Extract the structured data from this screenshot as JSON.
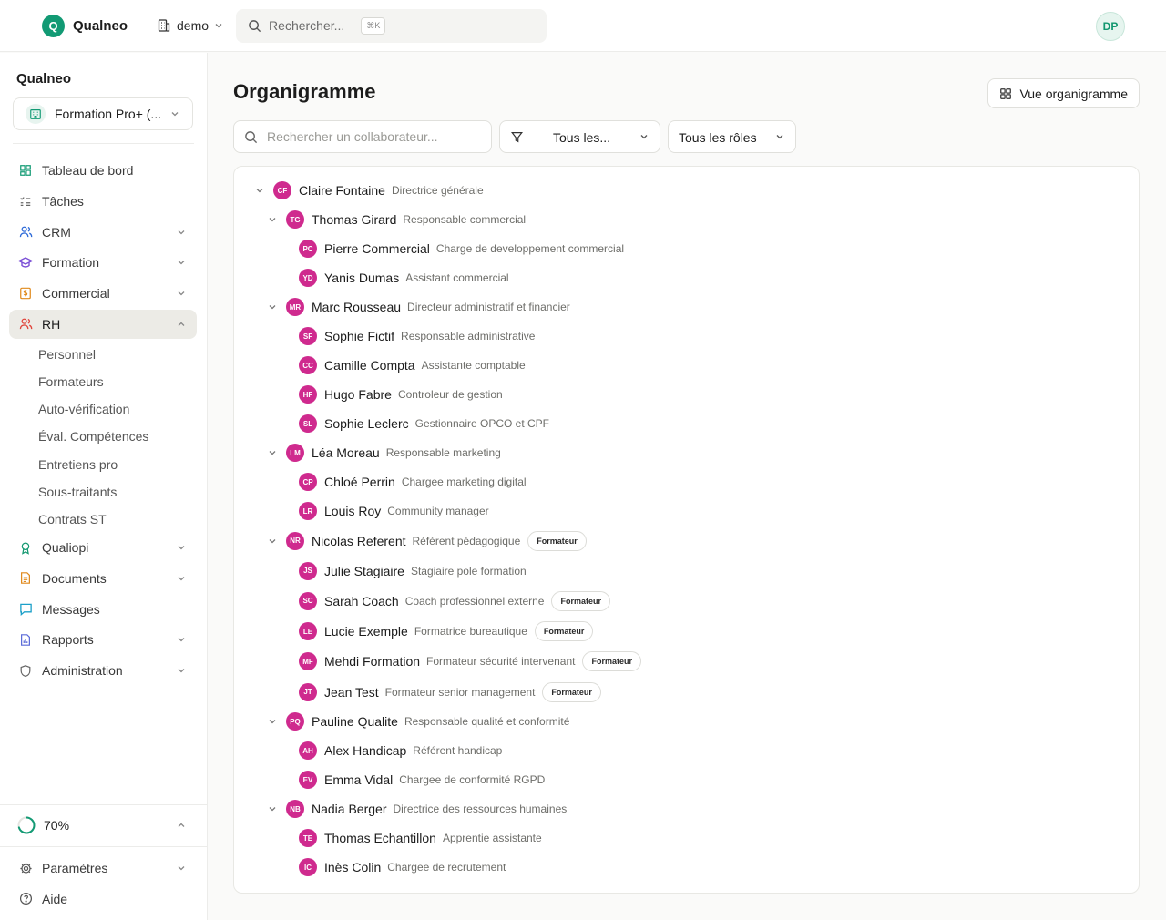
{
  "app": {
    "logo_letter": "Q",
    "brand": "Qualneo",
    "workspace": "demo",
    "search_placeholder": "Rechercher...",
    "search_shortcut": "⌘K",
    "user_initials": "DP"
  },
  "sidebar": {
    "org_title": "Qualneo",
    "org_select": "Formation Pro+ (...",
    "items": [
      {
        "label": "Tableau de bord",
        "icon": "dashboard-icon"
      },
      {
        "label": "Tâches",
        "icon": "tasks-icon"
      },
      {
        "label": "CRM",
        "icon": "users-icon"
      },
      {
        "label": "Formation",
        "icon": "graduation-cap-icon"
      },
      {
        "label": "Commercial",
        "icon": "dollar-file-icon"
      },
      {
        "label": "RH",
        "icon": "people-icon"
      },
      {
        "label": "Qualiopi",
        "icon": "award-icon"
      },
      {
        "label": "Documents",
        "icon": "document-icon"
      },
      {
        "label": "Messages",
        "icon": "message-icon"
      },
      {
        "label": "Rapports",
        "icon": "report-icon"
      },
      {
        "label": "Administration",
        "icon": "shield-icon"
      }
    ],
    "rh_sub": [
      "Personnel",
      "Formateurs",
      "Auto-vérification",
      "Éval. Compétences",
      "Entretiens pro",
      "Sous-traitants",
      "Contrats ST"
    ],
    "progress": {
      "label": "70%",
      "value": 0.7
    },
    "bottom": [
      {
        "label": "Paramètres",
        "icon": "gear-icon"
      },
      {
        "label": "Aide",
        "icon": "help-icon"
      }
    ]
  },
  "main": {
    "title": "Organigramme",
    "view_button": "Vue organigramme",
    "search_placeholder": "Rechercher un collaborateur...",
    "filter_department": "Tous les...",
    "filter_roles": "Tous les rôles"
  },
  "tree": [
    {
      "initials": "CF",
      "name": "Claire Fontaine",
      "role": "Directrice générale",
      "level": 0,
      "expandable": true
    },
    {
      "initials": "TG",
      "name": "Thomas Girard",
      "role": "Responsable commercial",
      "level": 1,
      "expandable": true
    },
    {
      "initials": "PC",
      "name": "Pierre Commercial",
      "role": "Charge de developpement commercial",
      "level": 2
    },
    {
      "initials": "YD",
      "name": "Yanis Dumas",
      "role": "Assistant commercial",
      "level": 2
    },
    {
      "initials": "MR",
      "name": "Marc Rousseau",
      "role": "Directeur administratif et financier",
      "level": 1,
      "expandable": true
    },
    {
      "initials": "SF",
      "name": "Sophie Fictif",
      "role": "Responsable administrative",
      "level": 2
    },
    {
      "initials": "CC",
      "name": "Camille Compta",
      "role": "Assistante comptable",
      "level": 2
    },
    {
      "initials": "HF",
      "name": "Hugo Fabre",
      "role": "Controleur de gestion",
      "level": 2
    },
    {
      "initials": "SL",
      "name": "Sophie Leclerc",
      "role": "Gestionnaire OPCO et CPF",
      "level": 2
    },
    {
      "initials": "LM",
      "name": "Léa Moreau",
      "role": "Responsable marketing",
      "level": 1,
      "expandable": true
    },
    {
      "initials": "CP",
      "name": "Chloé Perrin",
      "role": "Chargee marketing digital",
      "level": 2
    },
    {
      "initials": "LR",
      "name": "Louis Roy",
      "role": "Community manager",
      "level": 2
    },
    {
      "initials": "NR",
      "name": "Nicolas Referent",
      "role": "Référent pédagogique",
      "level": 1,
      "expandable": true,
      "badge": "Formateur"
    },
    {
      "initials": "JS",
      "name": "Julie Stagiaire",
      "role": "Stagiaire pole formation",
      "level": 2
    },
    {
      "initials": "SC",
      "name": "Sarah Coach",
      "role": "Coach professionnel externe",
      "level": 2,
      "badge": "Formateur"
    },
    {
      "initials": "LE",
      "name": "Lucie Exemple",
      "role": "Formatrice bureautique",
      "level": 2,
      "badge": "Formateur"
    },
    {
      "initials": "MF",
      "name": "Mehdi Formation",
      "role": "Formateur sécurité intervenant",
      "level": 2,
      "badge": "Formateur"
    },
    {
      "initials": "JT",
      "name": "Jean Test",
      "role": "Formateur senior management",
      "level": 2,
      "badge": "Formateur"
    },
    {
      "initials": "PQ",
      "name": "Pauline Qualite",
      "role": "Responsable qualité et conformité",
      "level": 1,
      "expandable": true
    },
    {
      "initials": "AH",
      "name": "Alex Handicap",
      "role": "Référent handicap",
      "level": 2
    },
    {
      "initials": "EV",
      "name": "Emma Vidal",
      "role": "Chargee de conformité RGPD",
      "level": 2
    },
    {
      "initials": "NB",
      "name": "Nadia Berger",
      "role": "Directrice des ressources humaines",
      "level": 1,
      "expandable": true
    },
    {
      "initials": "TE",
      "name": "Thomas Echantillon",
      "role": "Apprentie assistante",
      "level": 2
    },
    {
      "initials": "IC",
      "name": "Inès Colin",
      "role": "Chargee de recrutement",
      "level": 2
    }
  ],
  "colors": {
    "accent": "#129a74",
    "avatar": "#cf2a8e",
    "active_nav": "#ecebe6"
  }
}
